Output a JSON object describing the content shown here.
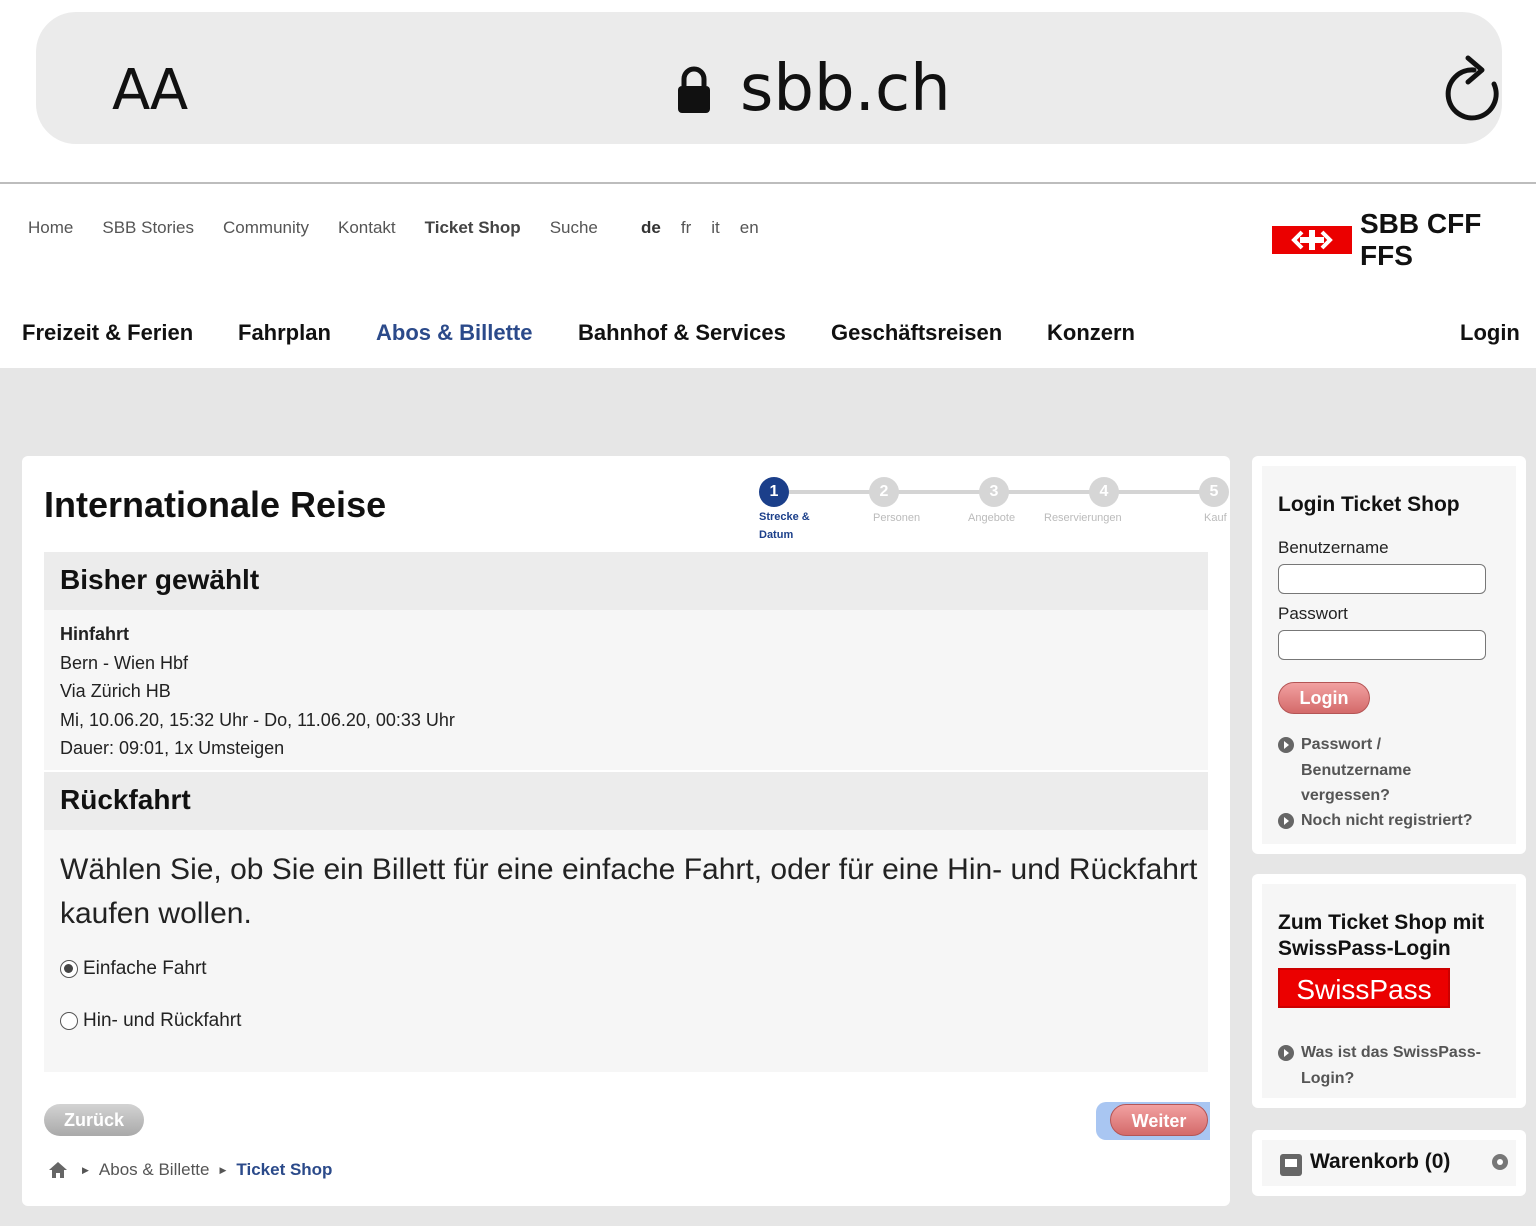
{
  "browser": {
    "text_size_label": "AA",
    "domain": "sbb.ch"
  },
  "meta_nav": {
    "links": [
      "Home",
      "SBB Stories",
      "Community",
      "Kontakt",
      "Ticket Shop",
      "Suche"
    ],
    "languages": [
      "de",
      "fr",
      "it",
      "en"
    ],
    "active_language": "de"
  },
  "logo": {
    "text": "SBB CFF FFS"
  },
  "main_nav": {
    "items": [
      "Freizeit & Ferien",
      "Fahrplan",
      "Abos & Billette",
      "Bahnhof & Services",
      "Geschäftsreisen",
      "Konzern"
    ],
    "active": "Abos & Billette",
    "login": "Login"
  },
  "main": {
    "title": "Internationale Reise",
    "steps": [
      {
        "number": "1",
        "label": "Strecke & Datum",
        "active": true
      },
      {
        "number": "2",
        "label": "Personen",
        "active": false
      },
      {
        "number": "3",
        "label": "Angebote",
        "active": false
      },
      {
        "number": "4",
        "label": "Reservierungen",
        "active": false
      },
      {
        "number": "5",
        "label": "Kauf",
        "active": false
      }
    ],
    "selected_heading": "Bisher gewählt",
    "outbound": {
      "label": "Hinfahrt",
      "route": "Bern - Wien Hbf",
      "via": "Via Zürich HB",
      "times": "Mi, 10.06.20, 15:32 Uhr - Do, 11.06.20, 00:33 Uhr",
      "duration": "Dauer: 09:01, 1x Umsteigen"
    },
    "return_heading": "Rückfahrt",
    "question": "Wählen Sie, ob Sie ein Billett für eine einfache Fahrt, oder für eine Hin- und Rückfahrt kaufen wollen.",
    "options": [
      {
        "label": "Einfache Fahrt",
        "checked": true
      },
      {
        "label": "Hin- und Rückfahrt",
        "checked": false
      }
    ],
    "back_button": "Zurück",
    "next_button": "Weiter"
  },
  "breadcrumb": {
    "items": [
      "Abos & Billette",
      "Ticket Shop"
    ]
  },
  "sidebar": {
    "login_box": {
      "title": "Login Ticket Shop",
      "username_label": "Benutzername",
      "password_label": "Passwort",
      "login_button": "Login",
      "forgot_link": "Passwort / Benutzername vergessen?",
      "register_link": "Noch nicht registriert?"
    },
    "swisspass_box": {
      "title": "Zum Ticket Shop mit SwissPass-Login",
      "logo_text": "SwissPass",
      "info_link": "Was ist das SwissPass-Login?"
    },
    "cart": {
      "label": "Warenkorb (0)"
    }
  },
  "colors": {
    "brand_red": "#eb0000",
    "nav_active_blue": "#2b4a8a",
    "step_active": "#1b3f8a"
  }
}
